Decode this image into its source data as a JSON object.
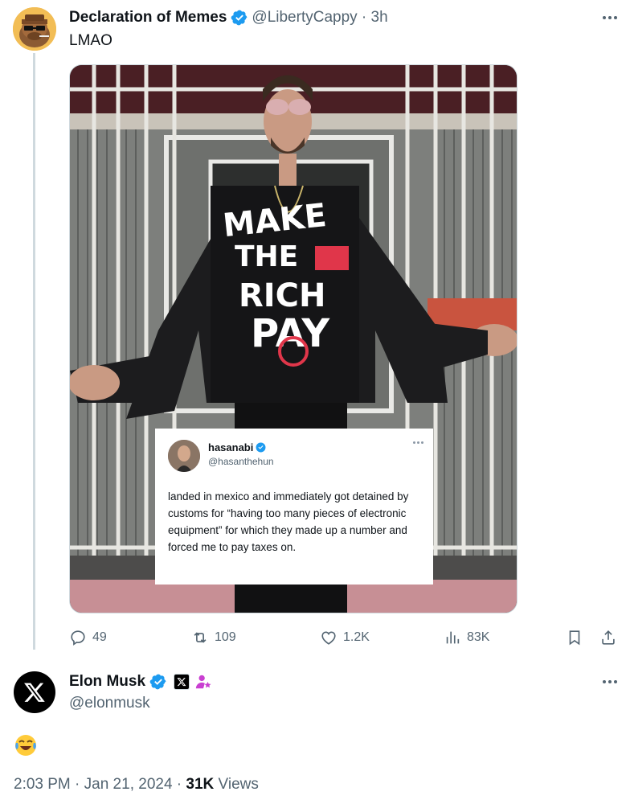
{
  "parent_tweet": {
    "author_name": "Declaration of Memes",
    "author_handle": "@LibertyCappy",
    "time_ago": "3h",
    "text": "LMAO",
    "media": {
      "shirt_text": [
        "MAKE",
        "THE",
        "RICH",
        "PAY"
      ],
      "embedded_tweet": {
        "author_name": "hasanabi",
        "author_handle": "@hasanthehun",
        "text": "landed in mexico and immediately got detained by customs for “having too many pieces of electronic equipment” for which they made up a number and forced me to pay taxes on."
      }
    },
    "actions": {
      "replies": "49",
      "reposts": "109",
      "likes": "1.2K",
      "views": "83K"
    }
  },
  "reply_tweet": {
    "author_name": "Elon Musk",
    "author_handle": "@elonmusk",
    "text": "😂",
    "timestamp": "2:03 PM · Jan 21, 2024",
    "views_count": "31K",
    "views_label": "Views"
  },
  "colors": {
    "text": "#0f1419",
    "secondary": "#536471",
    "verified_blue": "#1d9bf0",
    "thread_line": "#cfd9de",
    "shirt_accent": "#e0364a"
  },
  "icons": [
    "more-icon",
    "verified-icon",
    "reply-icon",
    "repost-icon",
    "like-icon",
    "views-icon",
    "bookmark-icon",
    "share-icon",
    "x-logo-icon",
    "affiliate-badge-icon",
    "role-badge-icon"
  ]
}
